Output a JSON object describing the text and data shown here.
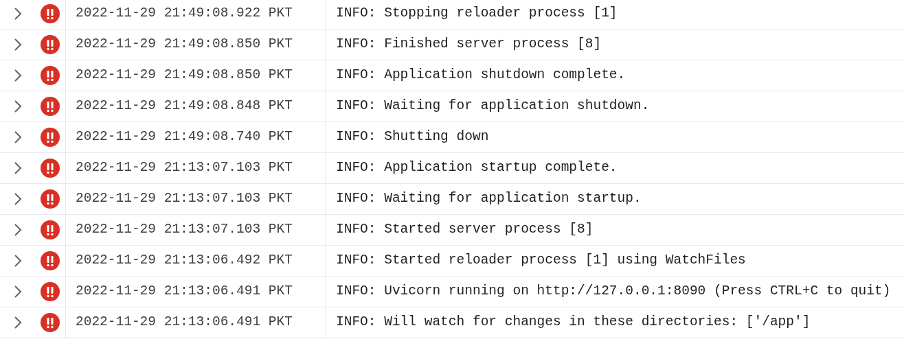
{
  "log_entries": [
    {
      "expanded": false,
      "kind": "error",
      "timestamp": "2022-11-29 21:49:08.922 PKT",
      "message": "INFO: Stopping reloader process [1]"
    },
    {
      "expanded": false,
      "kind": "error",
      "timestamp": "2022-11-29 21:49:08.850 PKT",
      "message": "INFO: Finished server process [8]"
    },
    {
      "expanded": false,
      "kind": "error",
      "timestamp": "2022-11-29 21:49:08.850 PKT",
      "message": "INFO: Application shutdown complete."
    },
    {
      "expanded": false,
      "kind": "error",
      "timestamp": "2022-11-29 21:49:08.848 PKT",
      "message": "INFO: Waiting for application shutdown."
    },
    {
      "expanded": false,
      "kind": "error",
      "timestamp": "2022-11-29 21:49:08.740 PKT",
      "message": "INFO: Shutting down"
    },
    {
      "expanded": false,
      "kind": "error",
      "timestamp": "2022-11-29 21:13:07.103 PKT",
      "message": "INFO: Application startup complete."
    },
    {
      "expanded": false,
      "kind": "error",
      "timestamp": "2022-11-29 21:13:07.103 PKT",
      "message": "INFO: Waiting for application startup."
    },
    {
      "expanded": false,
      "kind": "error",
      "timestamp": "2022-11-29 21:13:07.103 PKT",
      "message": "INFO: Started server process [8]"
    },
    {
      "expanded": false,
      "kind": "error",
      "timestamp": "2022-11-29 21:13:06.492 PKT",
      "message": "INFO: Started reloader process [1] using WatchFiles"
    },
    {
      "expanded": false,
      "kind": "error",
      "timestamp": "2022-11-29 21:13:06.491 PKT",
      "message": "INFO: Uvicorn running on http://127.0.0.1:8090 (Press CTRL+C to quit)"
    },
    {
      "expanded": false,
      "kind": "error",
      "timestamp": "2022-11-29 21:13:06.491 PKT",
      "message": "INFO: Will watch for changes in these directories: ['/app']"
    }
  ]
}
